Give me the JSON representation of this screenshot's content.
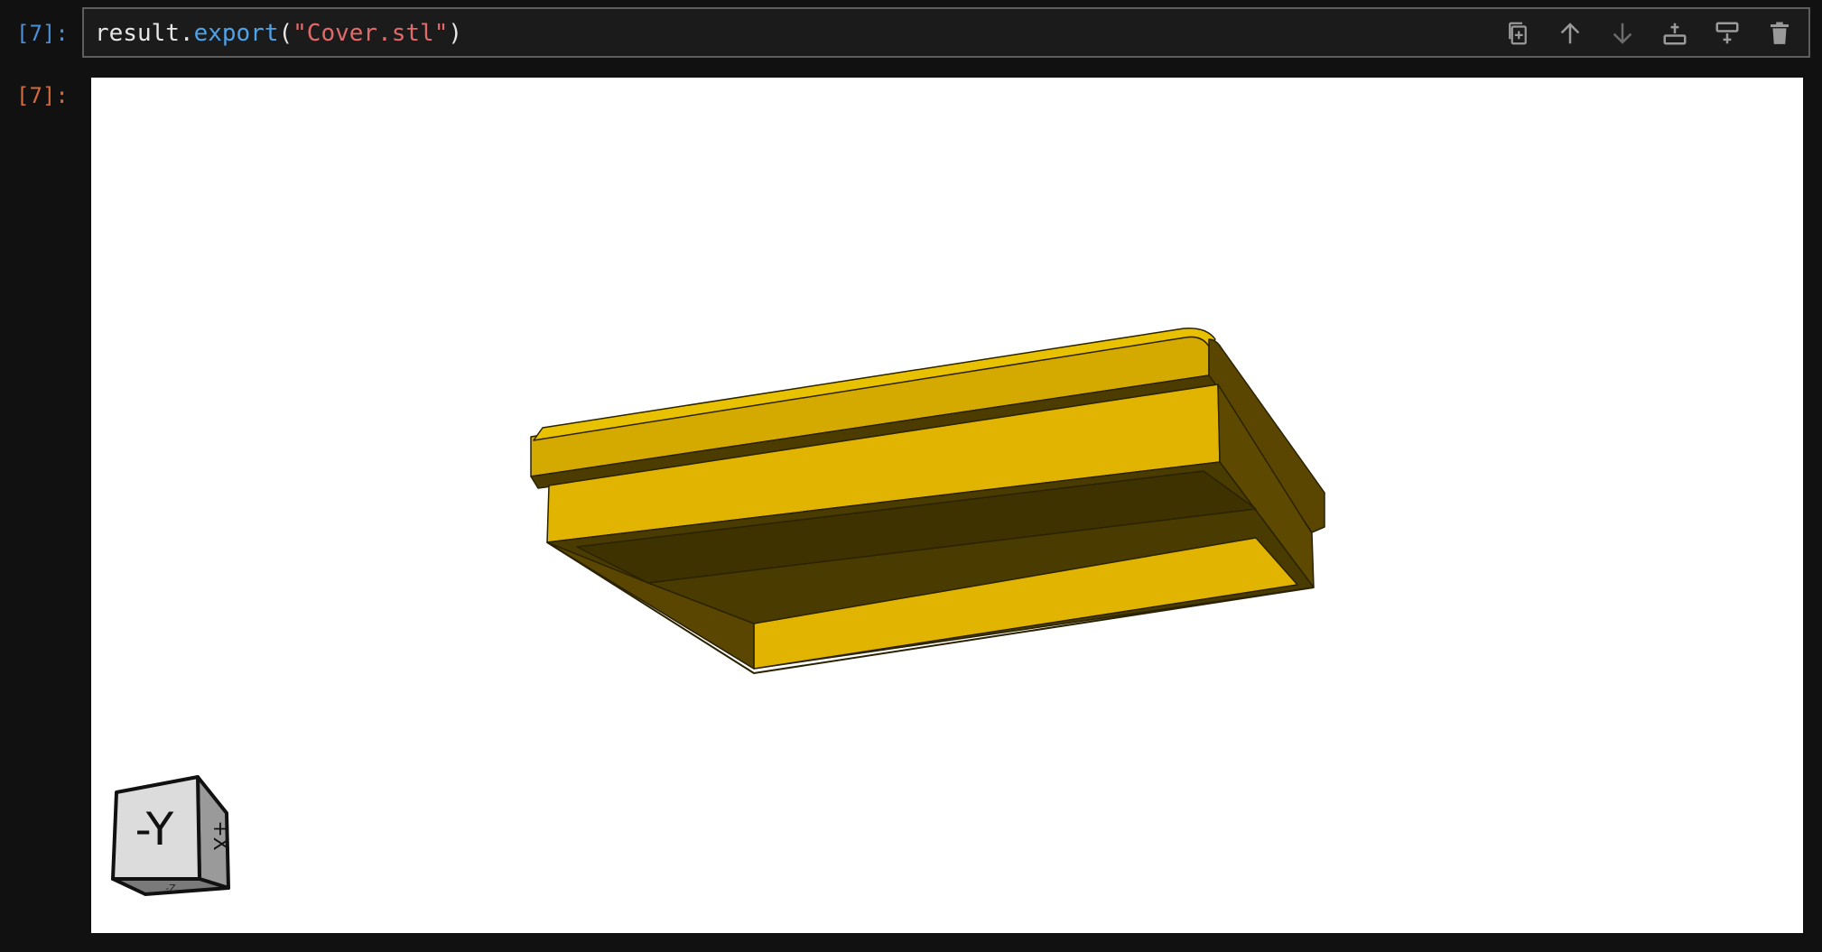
{
  "cell": {
    "input_prompt": "[7]:",
    "output_prompt": "[7]:",
    "code": {
      "obj": "result",
      "dot": ".",
      "method": "export",
      "open": "(",
      "arg": "\"Cover.stl\"",
      "close": ")"
    }
  },
  "toolbar": {
    "buttons": [
      {
        "name": "duplicate-cell",
        "icon": "duplicate-icon"
      },
      {
        "name": "move-up",
        "icon": "arrow-up-icon"
      },
      {
        "name": "move-down",
        "icon": "arrow-down-icon"
      },
      {
        "name": "insert-above",
        "icon": "insert-above-icon"
      },
      {
        "name": "insert-below",
        "icon": "insert-below-icon"
      },
      {
        "name": "delete-cell",
        "icon": "trash-icon"
      }
    ]
  },
  "viewer": {
    "model_color": "#e0b400",
    "shadow_color": "#5a4600",
    "dark_color": "#3e3200",
    "orientation_cube": {
      "front_label": "-Y",
      "side_label": "+X",
      "bottom_label": "-Z"
    }
  }
}
